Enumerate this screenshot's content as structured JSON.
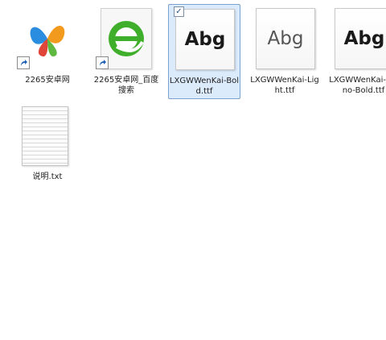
{
  "items": [
    {
      "label": "2265安卓网",
      "icon": "msn-butterfly-icon",
      "shortcut": true
    },
    {
      "label": "2265安卓网_百度搜索",
      "icon": "360-browser-icon",
      "shortcut": true
    },
    {
      "label": "LXGWWenKai-Bold.ttf",
      "icon": "font-file-icon",
      "preview": "Abg",
      "selected": true
    },
    {
      "label": "LXGWWenKai-Light.ttf",
      "icon": "font-file-icon",
      "preview": "Abg"
    },
    {
      "label": "LXGWWenKai-Mono-Bold.ttf",
      "icon": "font-file-icon",
      "preview": "Abg"
    },
    {
      "label": "说明.txt",
      "icon": "text-file-icon"
    }
  ],
  "colors": {
    "selection": "#dcebfc",
    "selection_border": "#7da2ce"
  }
}
